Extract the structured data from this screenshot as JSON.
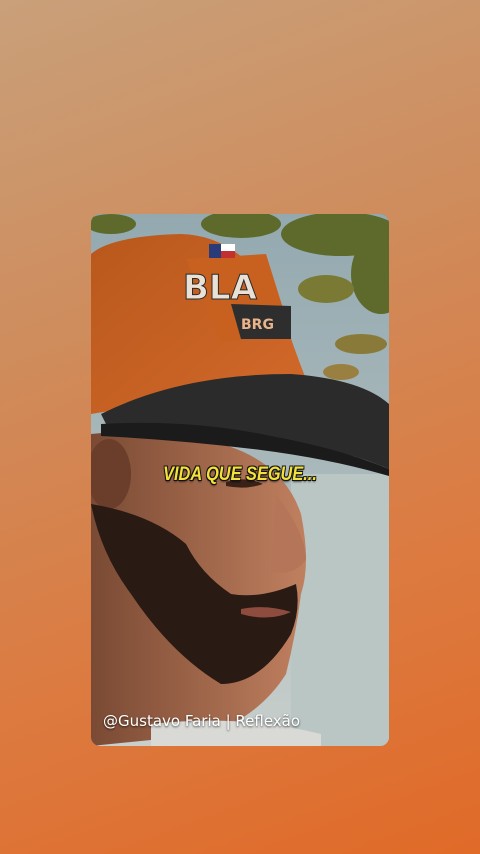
{
  "story": {
    "caption": "VIDA QUE SEGUE...",
    "credit": "@Gustavo Faria | Reflexão",
    "cap_logo_text": "BLA"
  },
  "colors": {
    "background_top": "#c9a07a",
    "background_bottom": "#e06a28",
    "caption_text": "#f4e23a",
    "credit_text": "#ffffff",
    "cap_orange": "#c8611f",
    "cap_brim": "#2a2a2a"
  }
}
